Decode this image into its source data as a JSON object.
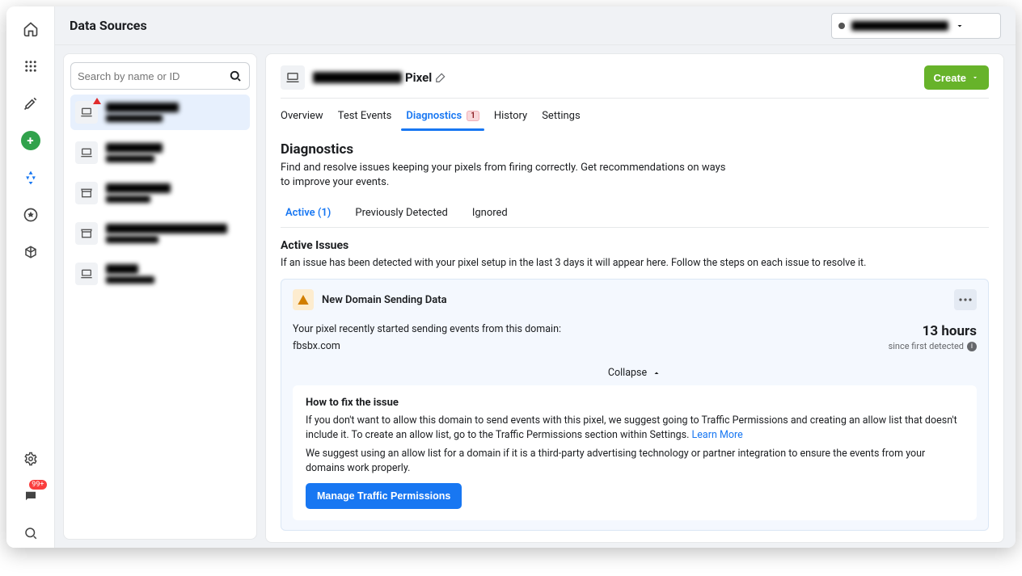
{
  "topbar": {
    "title": "Data Sources"
  },
  "search": {
    "placeholder": "Search by name or ID"
  },
  "asset": {
    "title_suffix": "Pixel"
  },
  "tabs": {
    "overview": "Overview",
    "test_events": "Test Events",
    "diagnostics": "Diagnostics",
    "diagnostics_count": "1",
    "history": "History",
    "settings": "Settings"
  },
  "buttons": {
    "create": "Create",
    "manage_traffic": "Manage Traffic Permissions"
  },
  "diagnostics": {
    "title": "Diagnostics",
    "desc": "Find and resolve issues keeping your pixels from firing correctly. Get recommendations on ways to improve your events.",
    "filters": {
      "active": "Active (1)",
      "previously": "Previously Detected",
      "ignored": "Ignored"
    },
    "active_issues_title": "Active Issues",
    "active_issues_desc": "If an issue has been detected with your pixel setup in the last 3 days it will appear here. Follow the steps on each issue to resolve it."
  },
  "issue": {
    "title": "New Domain Sending Data",
    "body_lead": "Your pixel recently started sending events from this domain:",
    "domain": "fbsbx.com",
    "duration": "13 hours",
    "since": "since first detected",
    "collapse": "Collapse",
    "fix_title": "How to fix the issue",
    "fix_body1_a": "If you don't want to allow this domain to send events with this pixel, we suggest going to Traffic Permissions and creating an allow list that doesn't include it. To create an allow list, go to the Traffic Permissions section within Settings. ",
    "fix_body1_link": "Learn More",
    "fix_body2": "We suggest using an allow list for a domain if it is a third-party advertising technology or partner integration to ensure the events from your domains work properly."
  }
}
